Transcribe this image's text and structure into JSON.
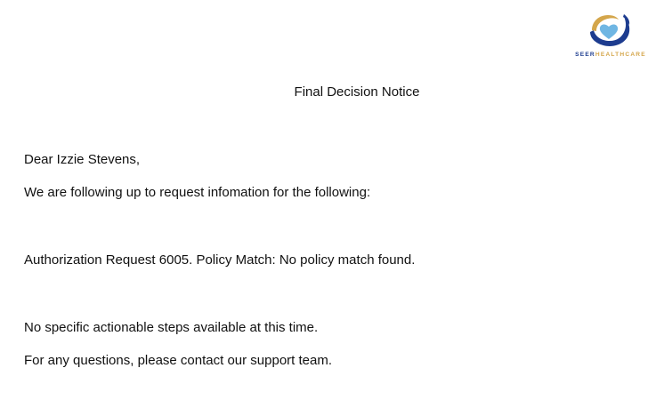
{
  "logo": {
    "brand_part1": "SEER",
    "brand_part2": "HEALTHCARE",
    "colors": {
      "navy": "#1d3c8f",
      "gold": "#d4a64b",
      "light_blue": "#6fb6e3"
    },
    "icon": "heart-hands-logo-icon"
  },
  "notice": {
    "title": "Final Decision Notice",
    "greeting": "Dear Izzie Stevens,",
    "intro": "We are following up to request infomation for the following:",
    "request_line": "Authorization Request 6005. Policy Match: No policy match found.",
    "steps": "No specific actionable steps available at this time.",
    "contact": "For any questions, please contact our support team."
  }
}
